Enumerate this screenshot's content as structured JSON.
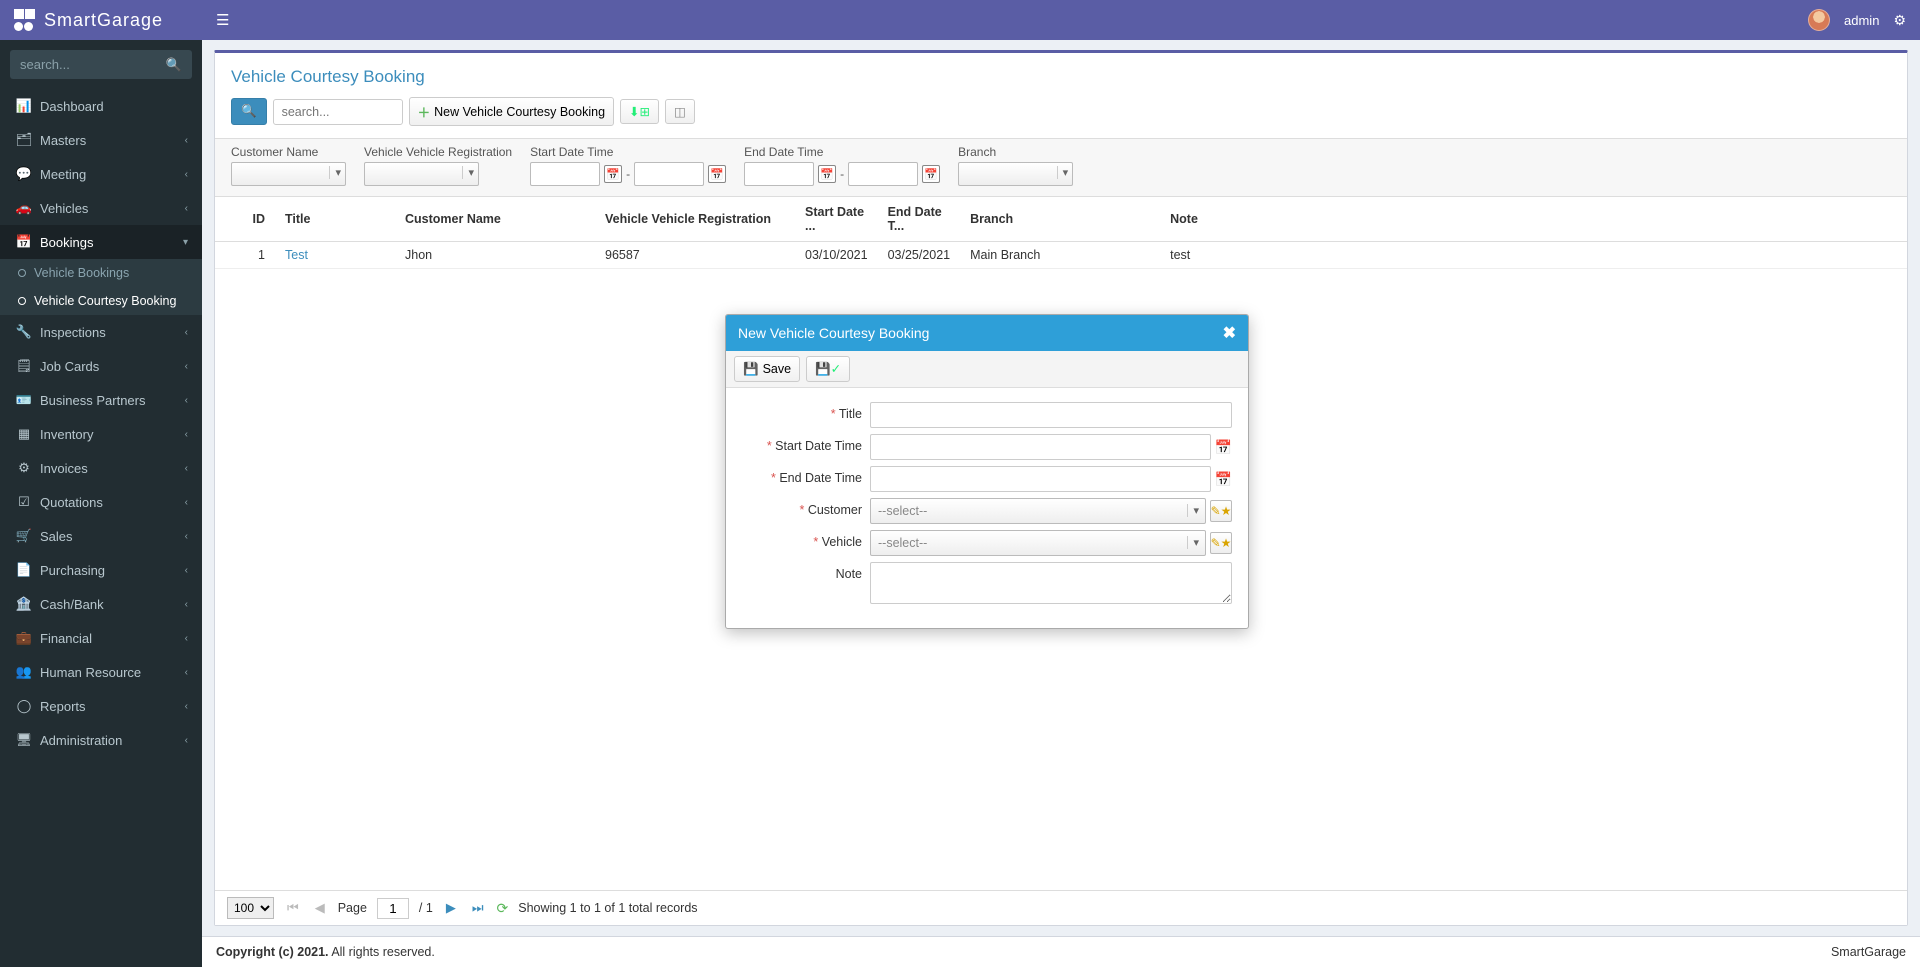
{
  "app": {
    "name": "SmartGarage",
    "user": "admin"
  },
  "sidebar": {
    "search_placeholder": "search...",
    "items": [
      {
        "icon": "📊",
        "label": "Dashboard",
        "expandable": false
      },
      {
        "icon": "🗂",
        "label": "Masters",
        "expandable": true
      },
      {
        "icon": "💬",
        "label": "Meeting",
        "expandable": true
      },
      {
        "icon": "🚗",
        "label": "Vehicles",
        "expandable": true
      },
      {
        "icon": "📅",
        "label": "Bookings",
        "expandable": true,
        "active": true,
        "children": [
          {
            "label": "Vehicle Bookings",
            "active": false
          },
          {
            "label": "Vehicle Courtesy Booking",
            "active": true
          }
        ]
      },
      {
        "icon": "🔧",
        "label": "Inspections",
        "expandable": true
      },
      {
        "icon": "🗒",
        "label": "Job Cards",
        "expandable": true
      },
      {
        "icon": "🪪",
        "label": "Business Partners",
        "expandable": true
      },
      {
        "icon": "▦",
        "label": "Inventory",
        "expandable": true
      },
      {
        "icon": "⚙",
        "label": "Invoices",
        "expandable": true
      },
      {
        "icon": "☑",
        "label": "Quotations",
        "expandable": true
      },
      {
        "icon": "🛒",
        "label": "Sales",
        "expandable": true
      },
      {
        "icon": "📄",
        "label": "Purchasing",
        "expandable": true
      },
      {
        "icon": "🏦",
        "label": "Cash/Bank",
        "expandable": true
      },
      {
        "icon": "💼",
        "label": "Financial",
        "expandable": true
      },
      {
        "icon": "👥",
        "label": "Human Resource",
        "expandable": true
      },
      {
        "icon": "◯",
        "label": "Reports",
        "expandable": true
      },
      {
        "icon": "🖥",
        "label": "Administration",
        "expandable": true
      }
    ]
  },
  "page": {
    "title": "Vehicle Courtesy Booking",
    "search_placeholder": "search...",
    "new_button": "New Vehicle Courtesy Booking"
  },
  "filters": {
    "customer": "Customer Name",
    "vehicle": "Vehicle Vehicle Registration",
    "start": "Start Date Time",
    "end": "End Date Time",
    "branch": "Branch"
  },
  "grid": {
    "headers": [
      "ID",
      "Title",
      "Customer Name",
      "Vehicle Vehicle Registration",
      "Start Date ...",
      "End Date T...",
      "Branch",
      "Note"
    ],
    "rows": [
      {
        "id": "1",
        "title": "Test",
        "customer": "Jhon",
        "vehicle": "96587",
        "start": "03/10/2021",
        "end": "03/25/2021",
        "branch": "Main Branch",
        "note": "test"
      }
    ]
  },
  "pager": {
    "page_size": "100",
    "page_label": "Page",
    "current": "1",
    "total_pages": "/ 1",
    "summary": "Showing 1 to 1 of 1 total records"
  },
  "footer": {
    "copyright": "Copyright (c) 2021.",
    "rights": " All rights reserved.",
    "brand": "SmartGarage"
  },
  "modal": {
    "title": "New Vehicle Courtesy Booking",
    "save": "Save",
    "fields": {
      "title": "Title",
      "start": "Start Date Time",
      "end": "End Date Time",
      "customer": "Customer",
      "vehicle": "Vehicle",
      "note": "Note",
      "select_placeholder": "--select--"
    }
  }
}
